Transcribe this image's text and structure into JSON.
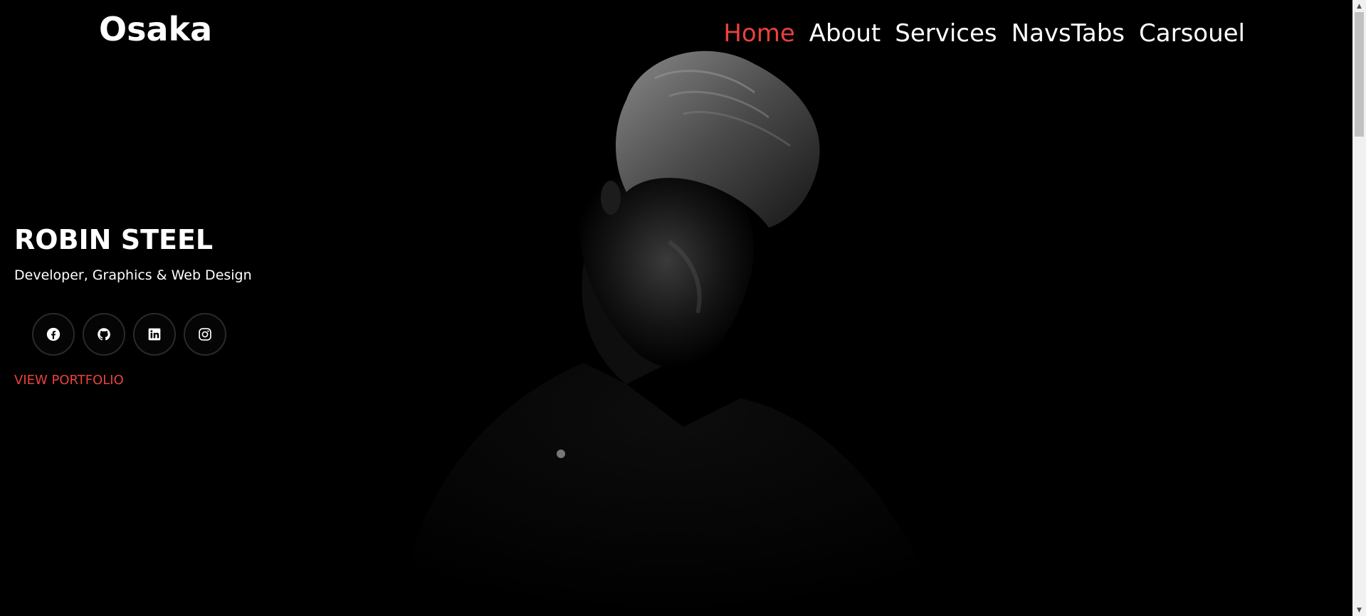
{
  "brand": "Osaka",
  "nav": {
    "items": [
      {
        "label": "Home",
        "active": true
      },
      {
        "label": "About",
        "active": false
      },
      {
        "label": "Services",
        "active": false
      },
      {
        "label": "NavsTabs",
        "active": false
      },
      {
        "label": "Carsouel",
        "active": false
      }
    ]
  },
  "hero": {
    "name": "ROBIN STEEL",
    "role": "Developer, Graphics & Web Design",
    "socials": [
      {
        "icon": "facebook-icon"
      },
      {
        "icon": "github-icon"
      },
      {
        "icon": "linkedin-icon"
      },
      {
        "icon": "instagram-icon"
      }
    ],
    "cta": "VIEW PORTFOLIO"
  },
  "colors": {
    "background": "#000000",
    "accent": "#e8433a",
    "text": "#ffffff"
  }
}
